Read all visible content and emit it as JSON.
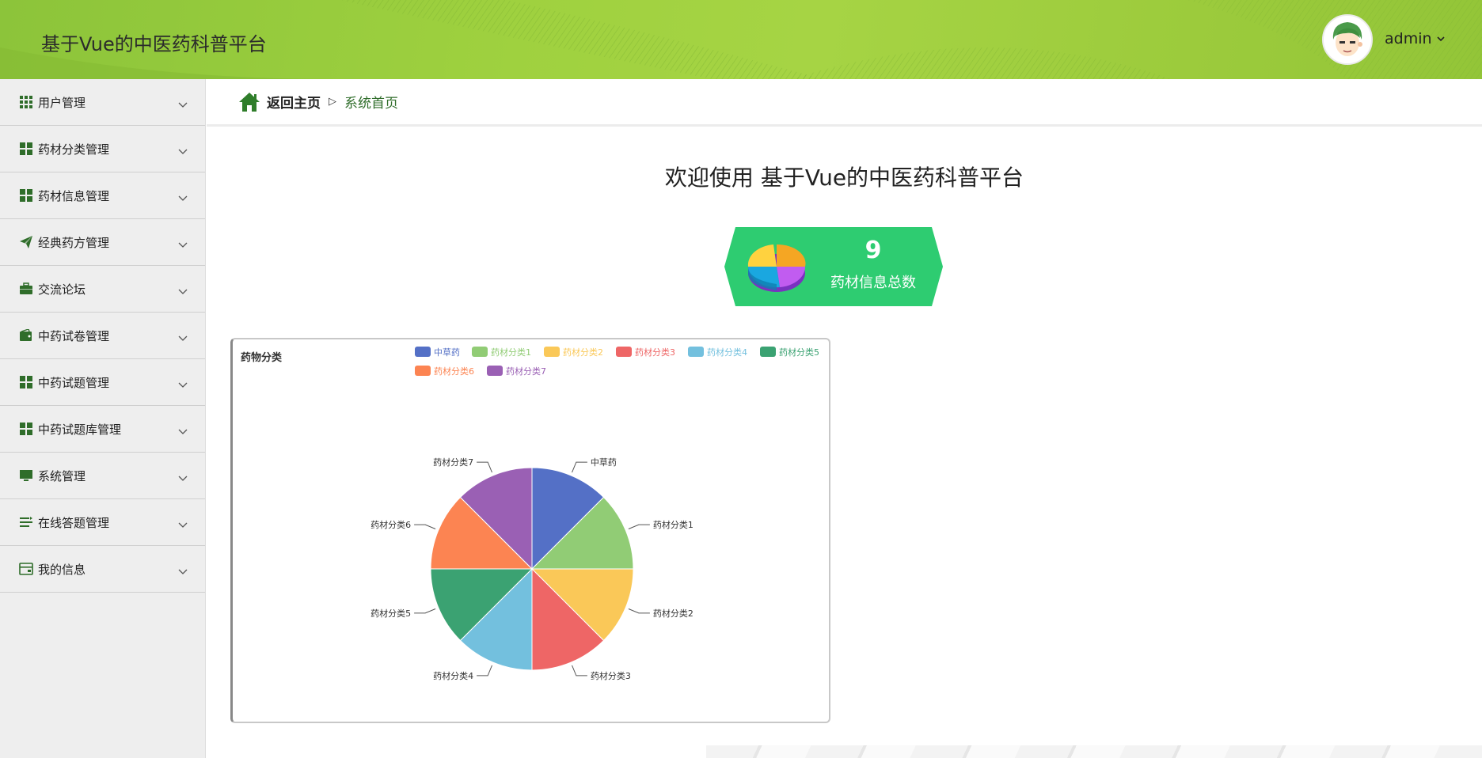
{
  "header": {
    "title": "基于Vue的中医药科普平台",
    "username": "admin",
    "accent": "#9fd13f"
  },
  "sidebar": {
    "items": [
      {
        "label": "用户管理",
        "icon": "grid-icon"
      },
      {
        "label": "药材分类管理",
        "icon": "apps-icon"
      },
      {
        "label": "药材信息管理",
        "icon": "apps-icon"
      },
      {
        "label": "经典药方管理",
        "icon": "paper-plane-icon"
      },
      {
        "label": "交流论坛",
        "icon": "briefcase-icon"
      },
      {
        "label": "中药试卷管理",
        "icon": "wallet-icon"
      },
      {
        "label": "中药试题管理",
        "icon": "apps-icon"
      },
      {
        "label": "中药试题库管理",
        "icon": "apps-icon"
      },
      {
        "label": "系统管理",
        "icon": "monitor-icon"
      },
      {
        "label": "在线答题管理",
        "icon": "list-icon"
      },
      {
        "label": "我的信息",
        "icon": "card-icon"
      }
    ],
    "icon_color": "#2f6d2a"
  },
  "breadcrumb": {
    "back": "返回主页",
    "separator": "▷",
    "current": "系统首页"
  },
  "welcome": "欢迎使用 基于Vue的中医药科普平台",
  "stat": {
    "value": "9",
    "caption": "药材信息总数",
    "color": "#2ecc71"
  },
  "chart_data": {
    "type": "pie",
    "title": "药物分类",
    "legend_position": "top-right",
    "categories": [
      "中草药",
      "药材分类1",
      "药材分类2",
      "药材分类3",
      "药材分类4",
      "药材分类5",
      "药材分类6",
      "药材分类7"
    ],
    "values": [
      1,
      1,
      1,
      1,
      1,
      1,
      1,
      1
    ],
    "colors": [
      "#5470c6",
      "#91cc75",
      "#fac858",
      "#ee6666",
      "#73c0de",
      "#3ba272",
      "#fc8452",
      "#9a60b4"
    ]
  }
}
